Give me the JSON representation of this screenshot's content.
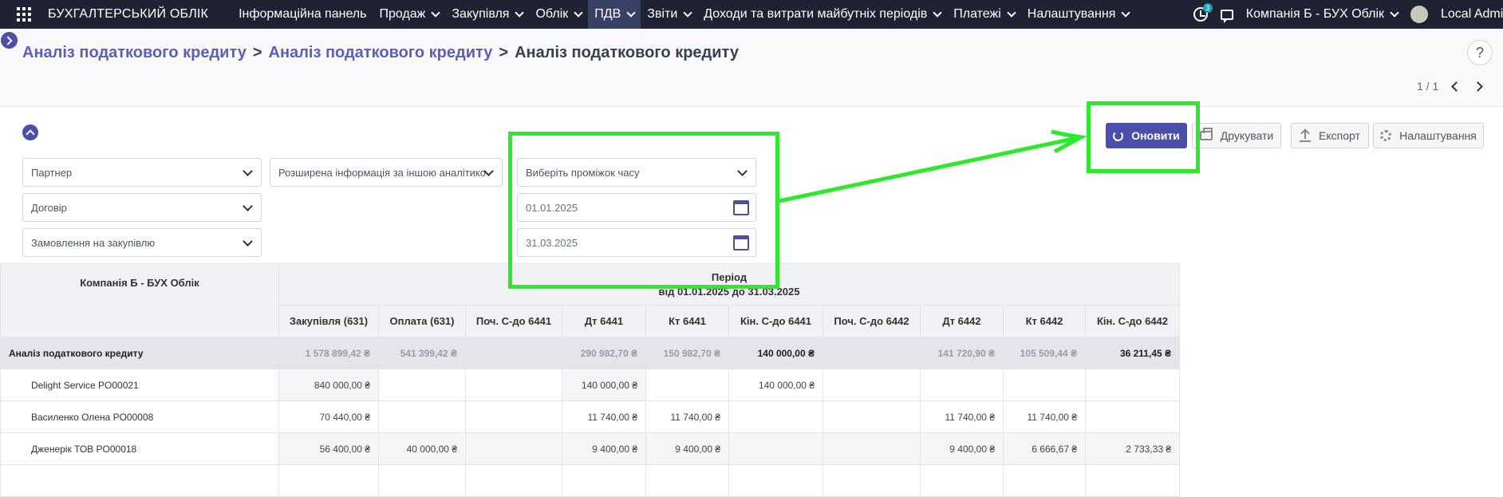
{
  "topbar": {
    "brand": "БУХГАЛТЕРСЬКИЙ ОБЛІК",
    "menu": [
      {
        "label": "Інформаційна панель",
        "dropdown": false,
        "active": false
      },
      {
        "label": "Продаж",
        "dropdown": true,
        "active": false
      },
      {
        "label": "Закупівля",
        "dropdown": true,
        "active": false
      },
      {
        "label": "Облік",
        "dropdown": true,
        "active": false
      },
      {
        "label": "ПДВ",
        "dropdown": true,
        "active": true
      },
      {
        "label": "Звіти",
        "dropdown": true,
        "active": false
      },
      {
        "label": "Доходи та витрати майбутніх періодів",
        "dropdown": true,
        "active": false
      },
      {
        "label": "Платежі",
        "dropdown": true,
        "active": false
      },
      {
        "label": "Налаштування",
        "dropdown": true,
        "active": false
      }
    ],
    "activity_badge": "3",
    "company": "Компанія Б - БУХ Облік",
    "user": "Local Admin"
  },
  "breadcrumb": {
    "items": [
      "Аналіз податкового кредиту",
      "Аналіз податкового кредиту"
    ],
    "current": "Аналіз податкового кредиту",
    "separator": ">"
  },
  "pager": {
    "text": "1 / 1"
  },
  "help": "?",
  "buttons": {
    "refresh": "Оновити",
    "print": "Друкувати",
    "export": "Експорт",
    "settings": "Налаштування"
  },
  "filters": {
    "partner": "Партнер",
    "extended": "Розширена інформація за іншою аналітико",
    "contract": "Договір",
    "purchase_order": "Замовлення на закупівлю",
    "period_select": "Виберіть проміжок часу",
    "date_from": "01.01.2025",
    "date_to": "31.03.2025"
  },
  "table": {
    "corner": "Компанія Б - БУХ Облік",
    "period_title": "Період",
    "period_range": "від 01.01.2025 до 31.03.2025",
    "columns": [
      "Закупівля (631)",
      "Оплата (631)",
      "Поч. С-до 6441",
      "Дт 6441",
      "Кт 6441",
      "Кін. С-до 6441",
      "Поч. С-до 6442",
      "Дт 6442",
      "Кт 6442",
      "Кін. С-до 6442"
    ],
    "total": {
      "label": "Аналіз податкового кредиту",
      "values": [
        "1 578 899,42 ₴",
        "541 399,42 ₴",
        "",
        "290 982,70 ₴",
        "150 982,70 ₴",
        "140 000,00 ₴",
        "",
        "141 720,90 ₴",
        "105 509,44 ₴",
        "36 211,45 ₴"
      ]
    },
    "rows": [
      {
        "label": "Delight Service PO00021",
        "values": [
          "840 000,00 ₴",
          "",
          "",
          "140 000,00 ₴",
          "",
          "140 000,00 ₴",
          "",
          "",
          "",
          ""
        ]
      },
      {
        "label": "Василенко Олена PO00008",
        "values": [
          "70 440,00 ₴",
          "",
          "",
          "11 740,00 ₴",
          "11 740,00 ₴",
          "",
          "",
          "11 740,00 ₴",
          "11 740,00 ₴",
          ""
        ]
      },
      {
        "label": "Дженерік ТОВ PO00018",
        "values": [
          "56 400,00 ₴",
          "40 000,00 ₴",
          "",
          "9 400,00 ₴",
          "9 400,00 ₴",
          "",
          "",
          "9 400,00 ₴",
          "6 666,67 ₴",
          "2 733,33 ₴"
        ]
      },
      {
        "label": "",
        "values": [
          "",
          "",
          "",
          "",
          "",
          "",
          "",
          "",
          "",
          ""
        ]
      }
    ]
  },
  "colors": {
    "nav_bg": "#1f2233",
    "accent": "#4b4fa8",
    "annotation": "#2ee82e"
  }
}
